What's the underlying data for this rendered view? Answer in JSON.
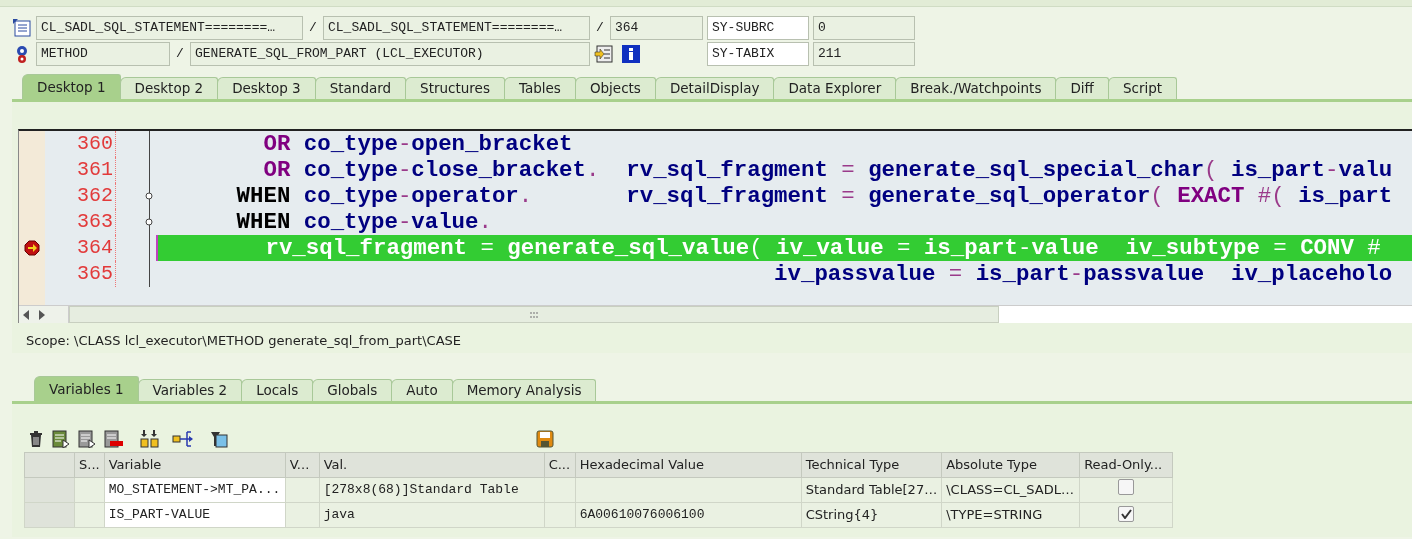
{
  "context": {
    "program_row": [
      {
        "value": "CL_SADL_SQL_STATEMENT========…"
      },
      {
        "sep": "/",
        "value": "CL_SADL_SQL_STATEMENT========…"
      },
      {
        "sep": "/",
        "value": "364"
      }
    ],
    "event_row": [
      {
        "value": "METHOD"
      },
      {
        "sep": "/",
        "value": "GENERATE_SQL_FROM_PART (LCL_EXECUTOR)"
      }
    ]
  },
  "system_fields": [
    {
      "name": "SY-SUBRC",
      "value": "0"
    },
    {
      "name": "SY-TABIX",
      "value": "211"
    }
  ],
  "desktop_tabs": [
    {
      "label": "Desktop 1",
      "selected": true
    },
    {
      "label": "Desktop 2",
      "selected": false
    },
    {
      "label": "Desktop 3",
      "selected": false
    },
    {
      "label": "Standard",
      "selected": false
    },
    {
      "label": "Structures",
      "selected": false
    },
    {
      "label": "Tables",
      "selected": false
    },
    {
      "label": "Objects",
      "selected": false
    },
    {
      "label": "DetailDisplay",
      "selected": false
    },
    {
      "label": "Data Explorer",
      "selected": false
    },
    {
      "label": "Break./Watchpoints",
      "selected": false
    },
    {
      "label": "Diff",
      "selected": false
    },
    {
      "label": "Script",
      "selected": false
    }
  ],
  "code_lines": [
    {
      "number": "360",
      "current": false,
      "breakpoint": false,
      "fold": false,
      "segments": [
        {
          "kind": "keyword",
          "text": "        OR"
        },
        {
          "kind": "name",
          "text": " co_type"
        },
        {
          "kind": "operator",
          "text": "-"
        },
        {
          "kind": "name",
          "text": "open_bracket"
        }
      ]
    },
    {
      "number": "361",
      "current": false,
      "breakpoint": false,
      "fold": false,
      "segments": [
        {
          "kind": "keyword",
          "text": "        OR"
        },
        {
          "kind": "name",
          "text": " co_type"
        },
        {
          "kind": "operator",
          "text": "-"
        },
        {
          "kind": "name",
          "text": "close_bracket"
        },
        {
          "kind": "operator",
          "text": "."
        },
        {
          "kind": "name",
          "text": "  rv_sql_fragment "
        },
        {
          "kind": "operator",
          "text": "="
        },
        {
          "kind": "name",
          "text": " generate_sql_special_char"
        },
        {
          "kind": "operator",
          "text": "("
        },
        {
          "kind": "name",
          "text": " is_part"
        },
        {
          "kind": "operator",
          "text": "-"
        },
        {
          "kind": "name",
          "text": "valu"
        }
      ]
    },
    {
      "number": "362",
      "current": false,
      "breakpoint": false,
      "fold": true,
      "segments": [
        {
          "kind": "statement",
          "text": "      WHEN"
        },
        {
          "kind": "name",
          "text": " co_type"
        },
        {
          "kind": "operator",
          "text": "-"
        },
        {
          "kind": "name",
          "text": "operator"
        },
        {
          "kind": "operator",
          "text": "."
        },
        {
          "kind": "name",
          "text": "       rv_sql_fragment "
        },
        {
          "kind": "operator",
          "text": "="
        },
        {
          "kind": "name",
          "text": " generate_sql_operator"
        },
        {
          "kind": "operator",
          "text": "("
        },
        {
          "kind": "keyword",
          "text": " EXACT"
        },
        {
          "kind": "operator",
          "text": " #("
        },
        {
          "kind": "name",
          "text": " is_part"
        }
      ]
    },
    {
      "number": "363",
      "current": false,
      "breakpoint": false,
      "fold": true,
      "segments": [
        {
          "kind": "statement",
          "text": "      WHEN"
        },
        {
          "kind": "name",
          "text": " co_type"
        },
        {
          "kind": "operator",
          "text": "-"
        },
        {
          "kind": "name",
          "text": "value"
        },
        {
          "kind": "operator",
          "text": "."
        }
      ]
    },
    {
      "number": "364",
      "current": true,
      "breakpoint": true,
      "fold": false,
      "segments": [
        {
          "kind": "name",
          "text": "        rv_sql_fragment "
        },
        {
          "kind": "operator",
          "text": "="
        },
        {
          "kind": "name",
          "text": " generate_sql_value"
        },
        {
          "kind": "operator",
          "text": "("
        },
        {
          "kind": "name",
          "text": " iv_value "
        },
        {
          "kind": "operator",
          "text": "="
        },
        {
          "kind": "name",
          "text": " is_part"
        },
        {
          "kind": "operator",
          "text": "-"
        },
        {
          "kind": "name",
          "text": "value  iv_subtype "
        },
        {
          "kind": "operator",
          "text": "="
        },
        {
          "kind": "keyword",
          "text": " CONV"
        },
        {
          "kind": "operator",
          "text": " #"
        }
      ]
    },
    {
      "number": "365",
      "current": false,
      "breakpoint": false,
      "fold": false,
      "segments": [
        {
          "kind": "name",
          "text": "                                              iv_passvalue "
        },
        {
          "kind": "operator",
          "text": "="
        },
        {
          "kind": "name",
          "text": " is_part"
        },
        {
          "kind": "operator",
          "text": "-"
        },
        {
          "kind": "name",
          "text": "passvalue  iv_placeholo"
        }
      ]
    }
  ],
  "scope": "Scope: \\CLASS lcl_executor\\METHOD generate_sql_from_part\\CASE",
  "variable_tabs": [
    {
      "label": "Variables 1",
      "selected": true
    },
    {
      "label": "Variables 2",
      "selected": false
    },
    {
      "label": "Locals",
      "selected": false
    },
    {
      "label": "Globals",
      "selected": false
    },
    {
      "label": "Auto",
      "selected": false
    },
    {
      "label": "Memory Analysis",
      "selected": false
    }
  ],
  "table": {
    "columns": [
      "S...",
      "Variable",
      "V...",
      "Val.",
      "C...",
      "Hexadecimal Value",
      "Technical Type",
      "Absolute Type",
      "Read-Only..."
    ],
    "rows": [
      {
        "variable": "MO_STATEMENT->MT_PA...",
        "value": "[278x8(68)]Standard Table",
        "technical_type": "Standard Table[27…",
        "absolute_type": "\\CLASS=CL_SADL…",
        "read_only": false
      },
      {
        "variable": "IS_PART-VALUE",
        "value": "java",
        "hex": "6A00610076006100",
        "technical_type": "CString{4}",
        "absolute_type": "\\TYPE=STRING",
        "read_only": true
      }
    ]
  }
}
